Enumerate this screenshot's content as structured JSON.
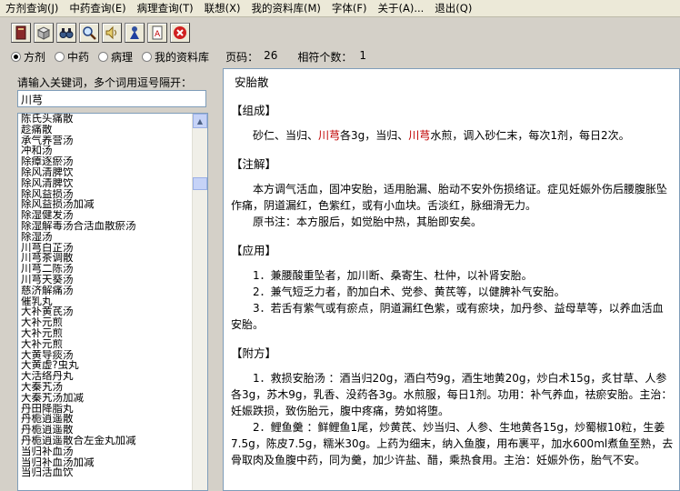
{
  "menu": [
    "方剂查询(J)",
    "中药查询(E)",
    "病理查询(T)",
    "联想(X)",
    "我的资料库(M)",
    "字体(F)",
    "关于(A)...",
    "退出(Q)"
  ],
  "toolbar": {
    "icons": [
      "book-icon",
      "box-icon",
      "binoculars-icon",
      "magnifier-icon",
      "speaker-icon",
      "person-icon",
      "document-icon",
      "close-icon"
    ]
  },
  "radios": [
    {
      "label": "方剂",
      "selected": true
    },
    {
      "label": "中药",
      "selected": false
    },
    {
      "label": "病理",
      "selected": false
    },
    {
      "label": "我的资料库",
      "selected": false
    }
  ],
  "pageinfo": {
    "page_label": "页码：",
    "page_value": "26",
    "count_label": "相符个数：",
    "count_value": "1"
  },
  "search": {
    "label": "请输入关键词，多个词用逗号隔开：",
    "value": "川芎"
  },
  "list_items": [
    "陈氏头痛散",
    "趁痛散",
    "承气养营汤",
    "冲和汤",
    "除瘴逐瘀汤",
    "除风清脾饮",
    "除风清脾饮",
    "除风益损汤",
    "除风益损汤加减",
    "除湿健发汤",
    "除湿解毒汤合活血散瘀汤",
    "除湿汤",
    "川芎白芷汤",
    "川芎茶调散",
    "川芎二陈汤",
    "川芎天葵汤",
    "慈济解痛汤",
    "催乳丸",
    "大补黄芪汤",
    "大补元煎",
    "大补元煎",
    "大补元煎",
    "大黄导痰汤",
    "大黄虚?虫丸",
    "大活络丹丸",
    "大秦艽汤",
    "大秦艽汤加减",
    "丹田降脂丸",
    "丹栀逍遥散",
    "丹栀逍遥散",
    "丹栀逍遥散合左金丸加减",
    "当归补血汤",
    "当归补血汤加减",
    "当归活血饮"
  ],
  "content": {
    "title": "安胎散",
    "sections": [
      {
        "heading": "【组成】",
        "paras": [
          [
            {
              "t": "砂仁、当归、"
            },
            {
              "t": "川芎",
              "red": true
            },
            {
              "t": "各3g，当归、"
            },
            {
              "t": "川芎",
              "red": true
            },
            {
              "t": "水煎，调入砂仁末，每次1剂，每日2次。"
            }
          ]
        ]
      },
      {
        "heading": "【注解】",
        "paras": [
          [
            {
              "t": "本方调气活血，固冲安胎，适用胎漏、胎动不安外伤损络证。症见妊娠外伤后腰腹胀坠作痛，阴道漏红，色紫红，或有小血块。舌淡红，脉细滑无力。"
            }
          ],
          [
            {
              "t": "原书注：本方服后，如觉胎中热，其胎即安矣。"
            }
          ]
        ]
      },
      {
        "heading": "【应用】",
        "paras": [
          [
            {
              "t": "1．兼腰酸重坠者，加川断、桑寄生、杜仲，以补肾安胎。"
            }
          ],
          [
            {
              "t": "2．兼气短乏力者，酌加白术、党参、黄芪等，以健脾补气安胎。"
            }
          ],
          [
            {
              "t": "3．若舌有紫气或有瘀点，阴道漏红色紫，或有瘀块，加丹参、益母草等，以养血活血安胎。"
            }
          ]
        ]
      },
      {
        "heading": "【附方】",
        "paras": [
          [
            {
              "t": "1．救损安胎汤 ：酒当归20g，酒白芍9g，酒生地黄20g，炒白术15g，炙甘草、人参各3g，苏木9g，乳香、没药各3g。水煎服，每日1剂。功用：补气养血，祛瘀安胎。主治：妊娠跌损，致伤胎元，腹中疼痛，势如将堕。"
            }
          ],
          [
            {
              "t": "2．鲤鱼羹 ：鲜鲤鱼1尾，炒黄芪、炒当归、人参、生地黄各15g，炒蜀椒10粒，生姜7.5g，陈皮7.5g，糯米30g。上药为细末，纳入鱼腹，用布裹平，加水600ml煮鱼至熟，去骨取肉及鱼腹中药，同为羹，加少许盐、醋，乘热食用。主治：妊娠外伤，胎气不安。"
            }
          ]
        ]
      }
    ]
  }
}
